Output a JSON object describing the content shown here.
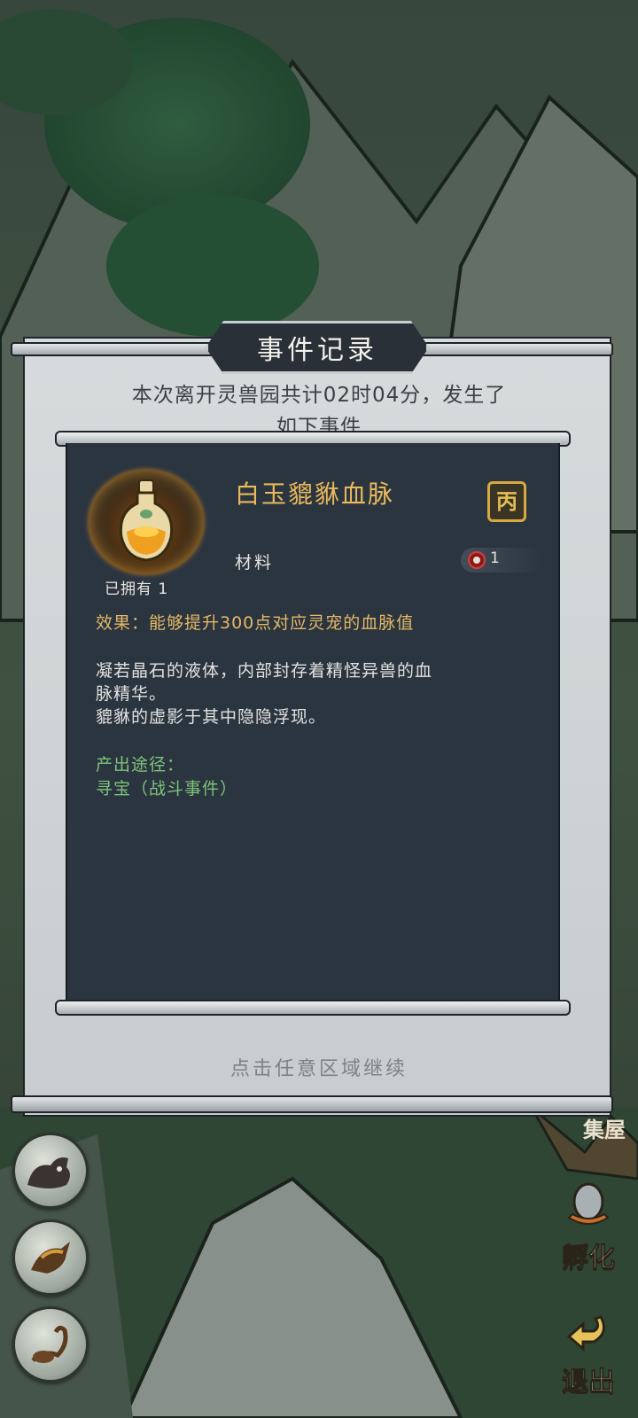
{
  "dialog": {
    "title": "事件记录",
    "intro_line1": "本次离开灵兽园共计02时04分，发生了",
    "intro_line2": "如下事件",
    "continue_hint": "点击任意区域继续"
  },
  "item": {
    "name": "白玉貔貅血脉",
    "rarity_badge": "丙",
    "category": "材料",
    "owned_label": "已拥有 1",
    "count": "1",
    "effect": "效果：能够提升300点对应灵宠的血脉值",
    "lore": [
      "凝若晶石的液体，内部封存着精怪异兽的血",
      "脉精华。",
      "貔貅的虚影于其中隐隐浮现。"
    ],
    "source_title": "产出途径：",
    "source_value": "寻宝（战斗事件）",
    "icon": "potion-bottle-icon"
  },
  "side_buttons": {
    "hatch": "孵化",
    "exit": "退出",
    "partial_label": "集屋"
  },
  "avatars": [
    "wolf-pet-avatar",
    "bird-pet-avatar",
    "scorpion-pet-avatar"
  ],
  "colors": {
    "title_plate": "#2a3038",
    "card_bg": "#2b3540",
    "item_name": "#e9b95c",
    "effect_text": "#e4b766",
    "source_text": "#7ec47a",
    "rarity_gold": "#d8a93e"
  }
}
